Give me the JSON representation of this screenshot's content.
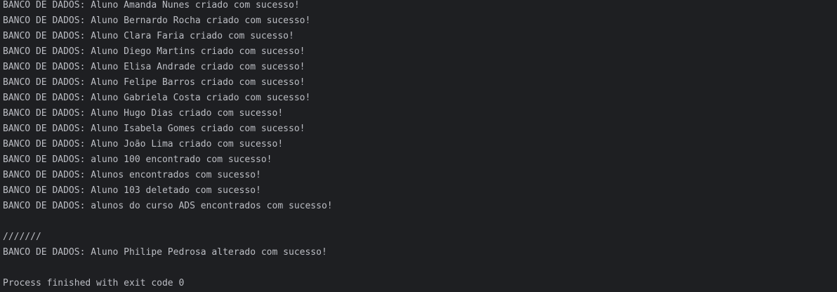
{
  "console": {
    "lines": [
      "BANCO DE DADOS: Aluno Amanda Nunes criado com sucesso!",
      "BANCO DE DADOS: Aluno Bernardo Rocha criado com sucesso!",
      "BANCO DE DADOS: Aluno Clara Faria criado com sucesso!",
      "BANCO DE DADOS: Aluno Diego Martins criado com sucesso!",
      "BANCO DE DADOS: Aluno Elisa Andrade criado com sucesso!",
      "BANCO DE DADOS: Aluno Felipe Barros criado com sucesso!",
      "BANCO DE DADOS: Aluno Gabriela Costa criado com sucesso!",
      "BANCO DE DADOS: Aluno Hugo Dias criado com sucesso!",
      "BANCO DE DADOS: Aluno Isabela Gomes criado com sucesso!",
      "BANCO DE DADOS: Aluno João Lima criado com sucesso!",
      "BANCO DE DADOS: aluno 100 encontrado com sucesso!",
      "BANCO DE DADOS: Alunos encontrados com sucesso!",
      "BANCO DE DADOS: Aluno 103 deletado com sucesso!",
      "BANCO DE DADOS: alunos do curso ADS encontrados com sucesso!",
      "",
      "///////",
      "BANCO DE DADOS: Aluno Philipe Pedrosa alterado com sucesso!",
      "",
      "Process finished with exit code 0"
    ]
  },
  "colors": {
    "background": "#1e1f22",
    "text": "#bcbec4"
  }
}
